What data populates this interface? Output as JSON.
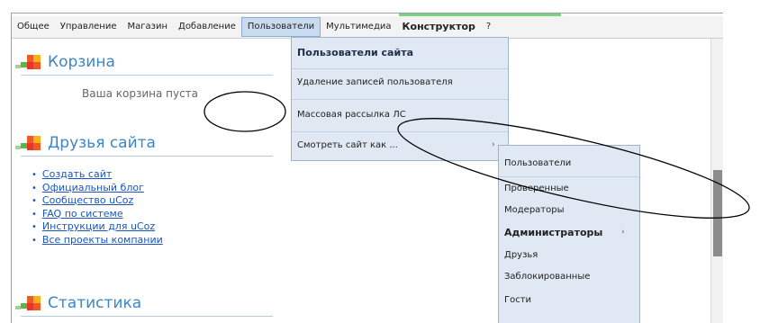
{
  "menubar": {
    "items": [
      "Общее",
      "Управление",
      "Магазин",
      "Добавление",
      "Пользователи",
      "Мультимедиа",
      "Конструктор",
      "?"
    ]
  },
  "sidebar": {
    "cart": {
      "title": "Корзина",
      "empty_text": "Ваша корзина пуста"
    },
    "friends": {
      "title": "Друзья сайта",
      "links": [
        "Создать сайт",
        "Официальный блог",
        "Сообщество uCoz",
        "FAQ по системе",
        "Инструкции для uCoz",
        "Все проекты компании"
      ]
    },
    "stats": {
      "title": "Статистика"
    }
  },
  "users_menu": {
    "items": [
      "Пользователи сайта",
      "Удаление записей пользователя",
      "Массовая рассылка ЛС",
      "Смотреть сайт как ..."
    ]
  },
  "view_as_submenu": {
    "items": [
      "Пользователи",
      "Проверенные",
      "Модераторы",
      "Администраторы",
      "Друзья",
      "Заблокированные",
      "Гости"
    ]
  },
  "colors": {
    "accent": "#3c86c8",
    "menu_bg": "#dfe8f3",
    "link": "#1a55c0"
  },
  "icons": {
    "cube": "block-cube-icon",
    "submenu_arrow": "submenu-arrow-icon",
    "bullet": "bullet-icon"
  }
}
